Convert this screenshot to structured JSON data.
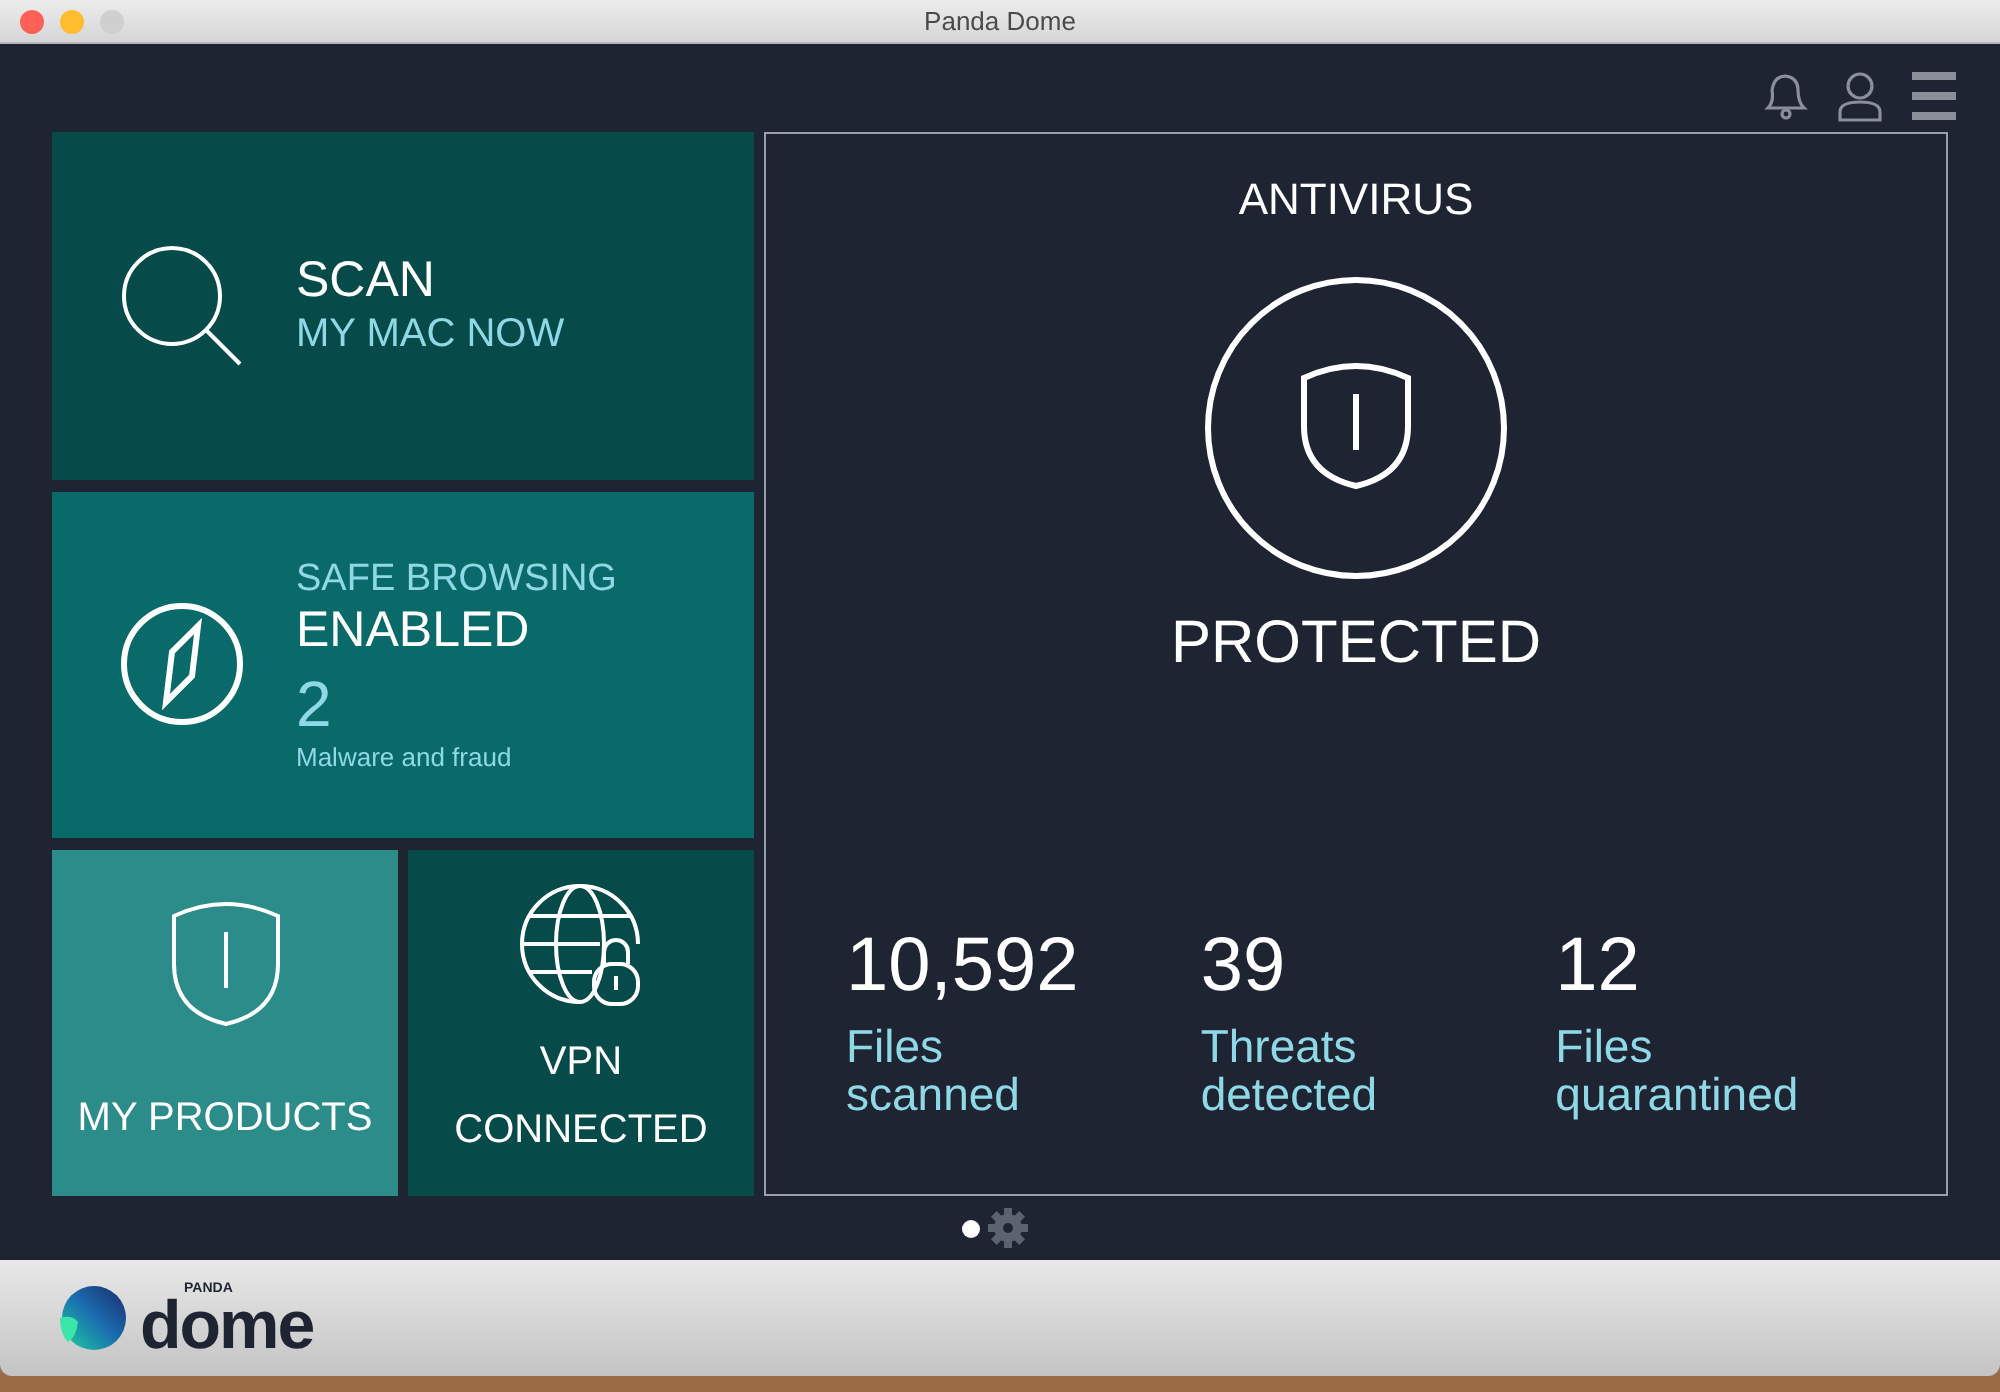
{
  "window": {
    "title": "Panda Dome"
  },
  "tiles": [
    {
      "kind": "scan",
      "title": "SCAN",
      "subtitle": "MY MAC NOW"
    },
    {
      "kind": "browsing",
      "title": "SAFE BROWSING",
      "subtitle": "ENABLED",
      "count": "2",
      "caption": "Malware and fraud"
    }
  ],
  "small_tiles": [
    {
      "kind": "products",
      "label": "MY PRODUCTS"
    },
    {
      "kind": "vpn",
      "label": "VPN",
      "status": "CONNECTED"
    }
  ],
  "antivirus": {
    "title": "ANTIVIRUS",
    "status": "PROTECTED",
    "stats": [
      {
        "value": "10,592",
        "label": "Files scanned"
      },
      {
        "value": "39",
        "label": "Threats detected"
      },
      {
        "value": "12",
        "label": "Files quarantined"
      }
    ]
  },
  "pages": [
    {
      "kind": "dot",
      "selected": true
    },
    {
      "kind": "gear",
      "selected": false
    }
  ],
  "logo": {
    "brand": "PANDA",
    "name": "dome"
  }
}
